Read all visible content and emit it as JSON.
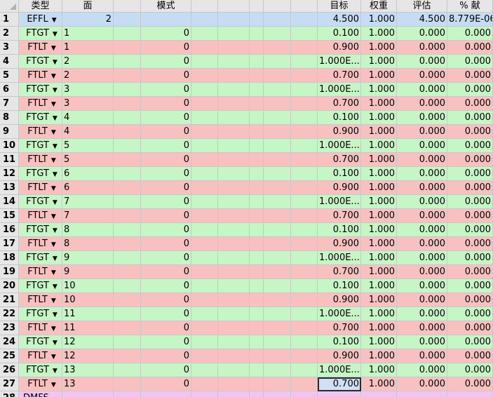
{
  "header": {
    "type": "类型",
    "surface": "面",
    "mode": "模式",
    "target": "目标",
    "weight": "权重",
    "value": "评估",
    "contrib": "% 献"
  },
  "rows": [
    {
      "num": "1",
      "type": "EFFL",
      "surf": "",
      "int2": "2",
      "mode": "",
      "target": "4.500",
      "weight": "1.000",
      "value": "4.500",
      "contrib": "8.779E-06",
      "color": "blue"
    },
    {
      "num": "2",
      "type": "FTGT",
      "surf": "1",
      "int2": "",
      "mode": "0",
      "target": "0.100",
      "weight": "1.000",
      "value": "0.000",
      "contrib": "0.000",
      "color": "green"
    },
    {
      "num": "3",
      "type": "FTLT",
      "surf": "1",
      "int2": "",
      "mode": "0",
      "target": "0.900",
      "weight": "1.000",
      "value": "0.000",
      "contrib": "0.000",
      "color": "red"
    },
    {
      "num": "4",
      "type": "FTGT",
      "surf": "2",
      "int2": "",
      "mode": "0",
      "target": "1.000E...",
      "weight": "1.000",
      "value": "0.000",
      "contrib": "0.000",
      "color": "green"
    },
    {
      "num": "5",
      "type": "FTLT",
      "surf": "2",
      "int2": "",
      "mode": "0",
      "target": "0.700",
      "weight": "1.000",
      "value": "0.000",
      "contrib": "0.000",
      "color": "red"
    },
    {
      "num": "6",
      "type": "FTGT",
      "surf": "3",
      "int2": "",
      "mode": "0",
      "target": "1.000E...",
      "weight": "1.000",
      "value": "0.000",
      "contrib": "0.000",
      "color": "green"
    },
    {
      "num": "7",
      "type": "FTLT",
      "surf": "3",
      "int2": "",
      "mode": "0",
      "target": "0.700",
      "weight": "1.000",
      "value": "0.000",
      "contrib": "0.000",
      "color": "red"
    },
    {
      "num": "8",
      "type": "FTGT",
      "surf": "4",
      "int2": "",
      "mode": "0",
      "target": "0.100",
      "weight": "1.000",
      "value": "0.000",
      "contrib": "0.000",
      "color": "green"
    },
    {
      "num": "9",
      "type": "FTLT",
      "surf": "4",
      "int2": "",
      "mode": "0",
      "target": "0.900",
      "weight": "1.000",
      "value": "0.000",
      "contrib": "0.000",
      "color": "red"
    },
    {
      "num": "10",
      "type": "FTGT",
      "surf": "5",
      "int2": "",
      "mode": "0",
      "target": "1.000E...",
      "weight": "1.000",
      "value": "0.000",
      "contrib": "0.000",
      "color": "green"
    },
    {
      "num": "11",
      "type": "FTLT",
      "surf": "5",
      "int2": "",
      "mode": "0",
      "target": "0.700",
      "weight": "1.000",
      "value": "0.000",
      "contrib": "0.000",
      "color": "red"
    },
    {
      "num": "12",
      "type": "FTGT",
      "surf": "6",
      "int2": "",
      "mode": "0",
      "target": "0.100",
      "weight": "1.000",
      "value": "0.000",
      "contrib": "0.000",
      "color": "green"
    },
    {
      "num": "13",
      "type": "FTLT",
      "surf": "6",
      "int2": "",
      "mode": "0",
      "target": "0.900",
      "weight": "1.000",
      "value": "0.000",
      "contrib": "0.000",
      "color": "red"
    },
    {
      "num": "14",
      "type": "FTGT",
      "surf": "7",
      "int2": "",
      "mode": "0",
      "target": "1.000E...",
      "weight": "1.000",
      "value": "0.000",
      "contrib": "0.000",
      "color": "green"
    },
    {
      "num": "15",
      "type": "FTLT",
      "surf": "7",
      "int2": "",
      "mode": "0",
      "target": "0.700",
      "weight": "1.000",
      "value": "0.000",
      "contrib": "0.000",
      "color": "red"
    },
    {
      "num": "16",
      "type": "FTGT",
      "surf": "8",
      "int2": "",
      "mode": "0",
      "target": "0.100",
      "weight": "1.000",
      "value": "0.000",
      "contrib": "0.000",
      "color": "green"
    },
    {
      "num": "17",
      "type": "FTLT",
      "surf": "8",
      "int2": "",
      "mode": "0",
      "target": "0.900",
      "weight": "1.000",
      "value": "0.000",
      "contrib": "0.000",
      "color": "red"
    },
    {
      "num": "18",
      "type": "FTGT",
      "surf": "9",
      "int2": "",
      "mode": "0",
      "target": "1.000E...",
      "weight": "1.000",
      "value": "0.000",
      "contrib": "0.000",
      "color": "green"
    },
    {
      "num": "19",
      "type": "FTLT",
      "surf": "9",
      "int2": "",
      "mode": "0",
      "target": "0.700",
      "weight": "1.000",
      "value": "0.000",
      "contrib": "0.000",
      "color": "red"
    },
    {
      "num": "20",
      "type": "FTGT",
      "surf": "10",
      "int2": "",
      "mode": "0",
      "target": "0.100",
      "weight": "1.000",
      "value": "0.000",
      "contrib": "0.000",
      "color": "green"
    },
    {
      "num": "21",
      "type": "FTLT",
      "surf": "10",
      "int2": "",
      "mode": "0",
      "target": "0.900",
      "weight": "1.000",
      "value": "0.000",
      "contrib": "0.000",
      "color": "red"
    },
    {
      "num": "22",
      "type": "FTGT",
      "surf": "11",
      "int2": "",
      "mode": "0",
      "target": "1.000E...",
      "weight": "1.000",
      "value": "0.000",
      "contrib": "0.000",
      "color": "green"
    },
    {
      "num": "23",
      "type": "FTLT",
      "surf": "11",
      "int2": "",
      "mode": "0",
      "target": "0.700",
      "weight": "1.000",
      "value": "0.000",
      "contrib": "0.000",
      "color": "red"
    },
    {
      "num": "24",
      "type": "FTGT",
      "surf": "12",
      "int2": "",
      "mode": "0",
      "target": "0.100",
      "weight": "1.000",
      "value": "0.000",
      "contrib": "0.000",
      "color": "green"
    },
    {
      "num": "25",
      "type": "FTLT",
      "surf": "12",
      "int2": "",
      "mode": "0",
      "target": "0.900",
      "weight": "1.000",
      "value": "0.000",
      "contrib": "0.000",
      "color": "red"
    },
    {
      "num": "26",
      "type": "FTGT",
      "surf": "13",
      "int2": "",
      "mode": "0",
      "target": "1.000E...",
      "weight": "1.000",
      "value": "0.000",
      "contrib": "0.000",
      "color": "green"
    },
    {
      "num": "27",
      "type": "FTLT",
      "surf": "13",
      "int2": "",
      "mode": "0",
      "target": "0.700",
      "weight": "1.000",
      "value": "0.000",
      "contrib": "0.000",
      "color": "red",
      "selected_target": true
    }
  ],
  "partial_row": {
    "num": "28",
    "type": "DMFS"
  },
  "dropdown_arrow": "▼",
  "colors": {
    "green": "#c6f5c6",
    "red": "#f9c0c0",
    "blue": "#c6dcf5",
    "pink": "#f3c4ef",
    "header": "#e6e6e6"
  }
}
